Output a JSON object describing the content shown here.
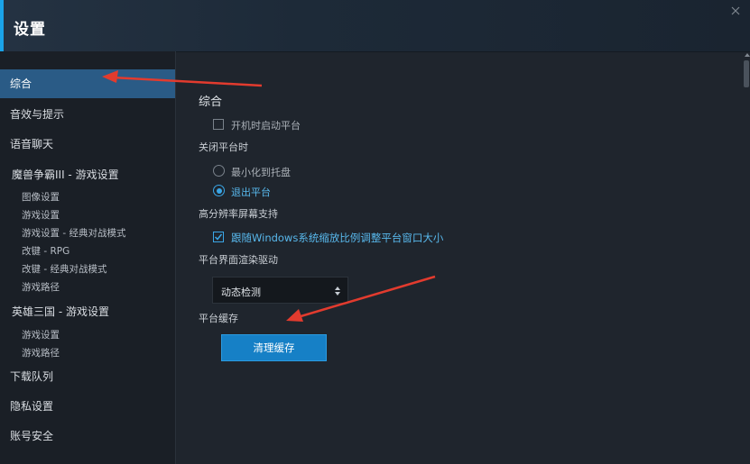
{
  "header": {
    "title": "设置"
  },
  "sidebar": {
    "items": [
      {
        "label": "综合"
      },
      {
        "label": "音效与提示"
      },
      {
        "label": "语音聊天"
      },
      {
        "label": "魔兽争霸III - 游戏设置"
      },
      {
        "label": "图像设置"
      },
      {
        "label": "游戏设置"
      },
      {
        "label": "游戏设置 - 经典对战模式"
      },
      {
        "label": "改键 - RPG"
      },
      {
        "label": "改键 - 经典对战模式"
      },
      {
        "label": "游戏路径"
      },
      {
        "label": "英雄三国 - 游戏设置"
      },
      {
        "label": "游戏设置"
      },
      {
        "label": "游戏路径"
      },
      {
        "label": "下载队列"
      },
      {
        "label": "隐私设置"
      },
      {
        "label": "账号安全"
      }
    ],
    "active": "综合"
  },
  "main": {
    "section_title": "综合",
    "startup": {
      "label": "开机时启动平台",
      "checked": false
    },
    "on_close": {
      "label": "关闭平台时",
      "options": [
        {
          "label": "最小化到托盘",
          "selected": false
        },
        {
          "label": "退出平台",
          "selected": true
        }
      ]
    },
    "hidpi": {
      "label": "高分辨率屏幕支持",
      "follow_scaling": {
        "label": "跟随Windows系统缩放比例调整平台窗口大小",
        "checked": true
      }
    },
    "render_driver": {
      "label": "平台界面渲染驱动",
      "value": "动态检测"
    },
    "cache": {
      "label": "平台缓存",
      "button_label": "清理缓存"
    }
  },
  "colors": {
    "accent": "#1aa3e8",
    "active_nav": "#2a5b86",
    "button": "#1680c6",
    "annotation_arrow": "#e23b2e"
  }
}
